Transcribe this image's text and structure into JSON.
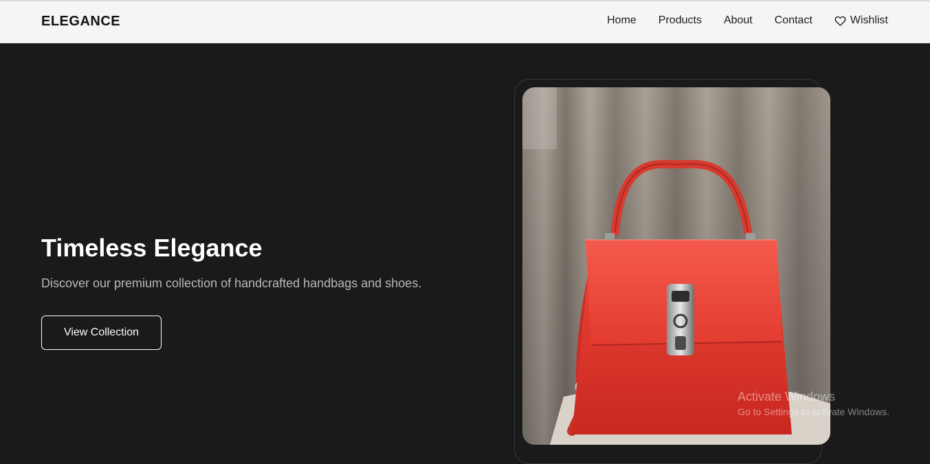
{
  "brand": {
    "logo": "ELEGANCE"
  },
  "nav": {
    "home": "Home",
    "products": "Products",
    "about": "About",
    "contact": "Contact",
    "wishlist": "Wishlist"
  },
  "hero": {
    "title": "Timeless Elegance",
    "subtitle": "Discover our premium collection of handcrafted handbags and shoes.",
    "cta_label": "View Collection"
  },
  "product_image": {
    "icon": "red-handbag-photo"
  },
  "icons": {
    "wishlist": "heart-icon"
  },
  "colors": {
    "background": "#1a1a1a",
    "navbar": "#f5f5f5",
    "bag": "#e8433a",
    "accent": "#ffffff"
  },
  "watermark": {
    "title": "Activate Windows",
    "subtitle": "Go to Settings to activate Windows."
  }
}
